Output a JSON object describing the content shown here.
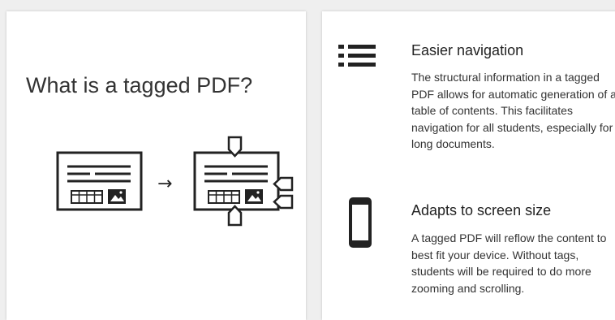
{
  "left_panel": {
    "title": "What is a tagged PDF?",
    "diagram": {
      "untagged_icon": "untagged-document-icon",
      "arrow": "→",
      "tagged_icon": "tagged-document-icon"
    }
  },
  "features": [
    {
      "icon": "list-icon",
      "heading": "Easier navigation",
      "body": "The structural information in a tagged PDF allows for automatic generation of a table of contents. This facilitates navigation for all students, especially for long documents."
    },
    {
      "icon": "tablet-icon",
      "heading": "Adapts to screen size",
      "body": "A tagged PDF will reflow the content to best fit your device. Without tags, students will be required to do more zooming and scrolling."
    }
  ],
  "colors": {
    "background": "#efefef",
    "card": "#ffffff",
    "ink": "#222222"
  }
}
